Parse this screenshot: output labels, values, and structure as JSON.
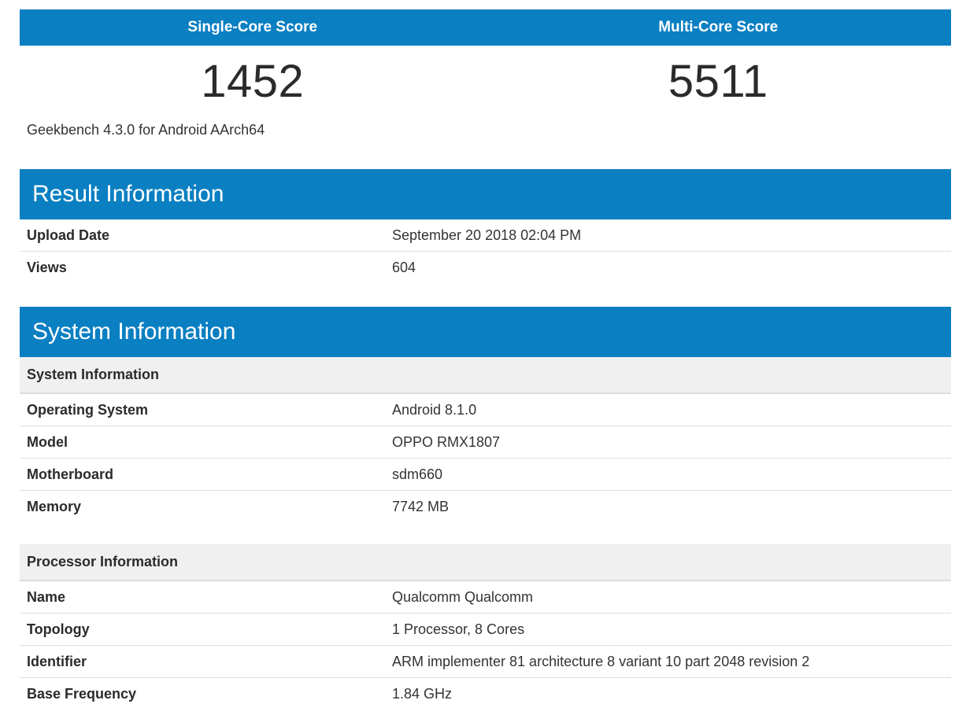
{
  "scores": {
    "single_core_label": "Single-Core Score",
    "multi_core_label": "Multi-Core Score",
    "single_core_value": "1452",
    "multi_core_value": "5511"
  },
  "version_text": "Geekbench 4.3.0 for Android AArch64",
  "result_information": {
    "title": "Result Information",
    "rows": [
      {
        "label": "Upload Date",
        "value": "September 20 2018 02:04 PM"
      },
      {
        "label": "Views",
        "value": "604"
      }
    ]
  },
  "system_information": {
    "title": "System Information",
    "system_subheader": "System Information",
    "system_rows": [
      {
        "label": "Operating System",
        "value": "Android 8.1.0"
      },
      {
        "label": "Model",
        "value": "OPPO RMX1807"
      },
      {
        "label": "Motherboard",
        "value": "sdm660"
      },
      {
        "label": "Memory",
        "value": "7742 MB"
      }
    ],
    "processor_subheader": "Processor Information",
    "processor_rows": [
      {
        "label": "Name",
        "value": "Qualcomm Qualcomm"
      },
      {
        "label": "Topology",
        "value": "1 Processor, 8 Cores"
      },
      {
        "label": "Identifier",
        "value": "ARM implementer 81 architecture 8 variant 10 part 2048 revision 2"
      },
      {
        "label": "Base Frequency",
        "value": "1.84 GHz"
      }
    ]
  },
  "colors": {
    "header_blue": "#0a7fc2",
    "subheader_bg": "#f0f0f0"
  }
}
